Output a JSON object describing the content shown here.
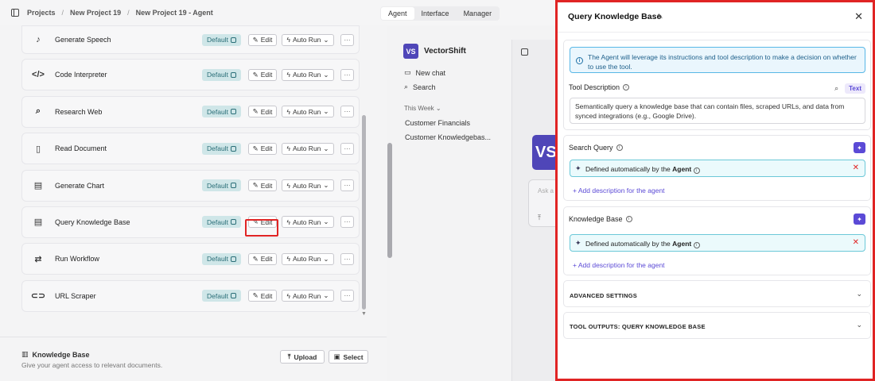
{
  "breadcrumb": {
    "projects": "Projects",
    "project": "New Project 19",
    "agent": "New Project 19 - Agent",
    "sep": "/"
  },
  "top_tabs": [
    {
      "label": "Agent"
    },
    {
      "label": "Interface"
    },
    {
      "label": "Manager"
    }
  ],
  "tools": [
    {
      "name": "Generate Speech",
      "icon": "speech-icon",
      "glyph": "♪"
    },
    {
      "name": "Code Interpreter",
      "icon": "code-icon",
      "glyph": "</>"
    },
    {
      "name": "Research Web",
      "icon": "search-icon",
      "glyph": "⌕"
    },
    {
      "name": "Read Document",
      "icon": "document-icon",
      "glyph": "▯"
    },
    {
      "name": "Generate Chart",
      "icon": "chart-icon",
      "glyph": "▤"
    },
    {
      "name": "Query Knowledge Base",
      "icon": "database-icon",
      "glyph": "▤"
    },
    {
      "name": "Run Workflow",
      "icon": "workflow-icon",
      "glyph": "⇄"
    },
    {
      "name": "URL Scraper",
      "icon": "link-icon",
      "glyph": "⊂⊃"
    }
  ],
  "tool_labels": {
    "badge": "Default",
    "edit": "Edit",
    "auto_run": "Auto Run",
    "more": "···"
  },
  "knowledge_base": {
    "title": "Knowledge Base",
    "subtitle": "Give your agent access to relevant documents.",
    "upload": "Upload",
    "select": "Select"
  },
  "chat": {
    "brand": "VectorShift",
    "logo": "VS",
    "new_chat": "New chat",
    "search": "Search",
    "this_week": "This Week ⌄",
    "history": [
      "Customer Financials",
      "Customer Knowledgebas..."
    ],
    "ask_placeholder": "Ask a"
  },
  "panel": {
    "title": "Query Knowledge Base",
    "info": "The Agent will leverage its instructions and tool description to make a decision on whether to use the tool.",
    "tool_description_label": "Tool Description",
    "text_toggle": "Text",
    "tool_description": "Semantically query a knowledge base that can contain files, scraped URLs, and data from synced integrations (e.g., Google Drive).",
    "search_query_label": "Search Query",
    "knowledge_base_label": "Knowledge Base",
    "auto_prefix": "Defined automatically by the",
    "auto_bold": "Agent",
    "add_description": "+ Add description for the agent",
    "advanced": "ADVANCED SETTINGS",
    "outputs": "TOOL OUTPUTS: QUERY KNOWLEDGE BASE"
  }
}
